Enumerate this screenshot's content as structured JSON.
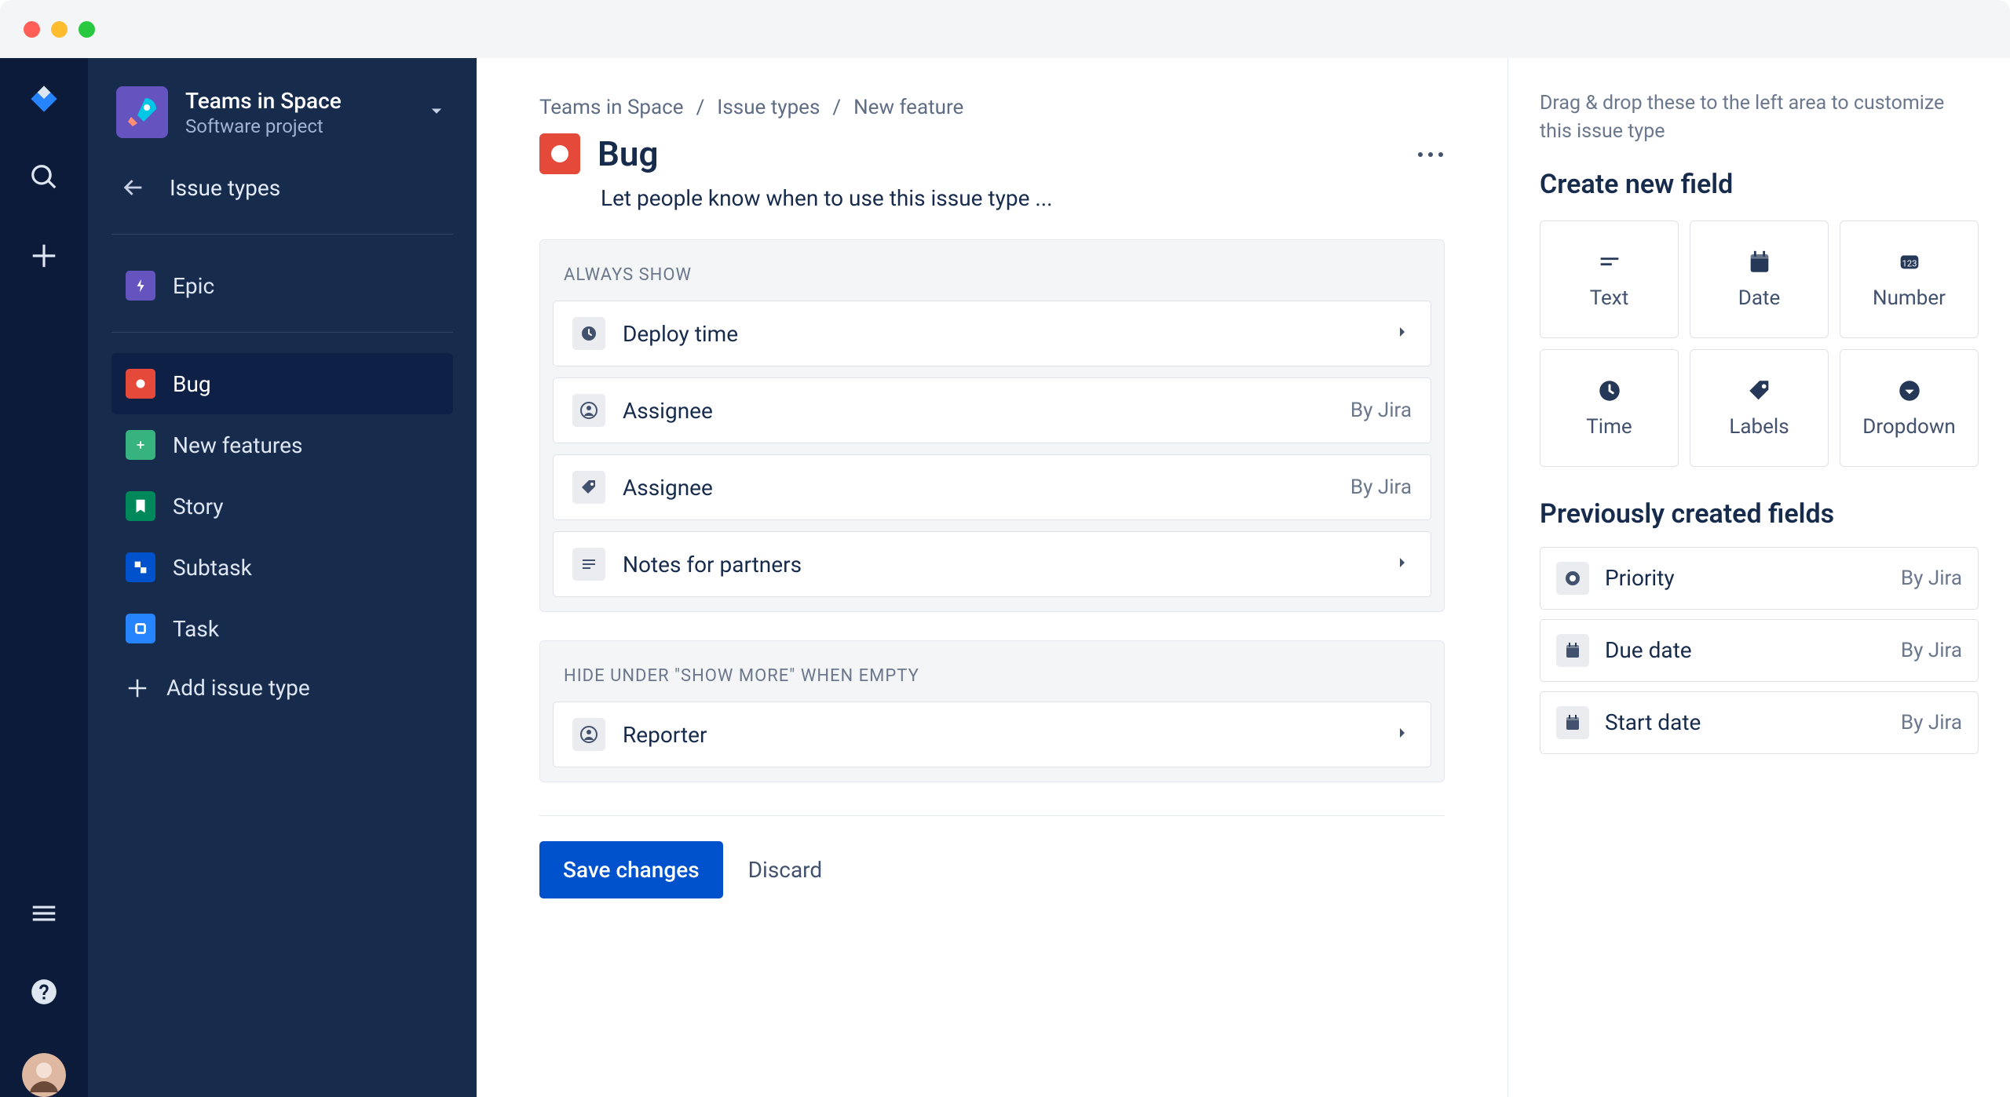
{
  "project": {
    "name": "Teams in Space",
    "subtitle": "Software project"
  },
  "sidebar": {
    "back_label": "Issue types",
    "epic": "Epic",
    "items": [
      "Bug",
      "New features",
      "Story",
      "Subtask",
      "Task"
    ],
    "add_label": "Add issue type"
  },
  "breadcrumbs": [
    "Teams in Space",
    "Issue types",
    "New feature"
  ],
  "page": {
    "title": "Bug",
    "description": "Let people know when to use this issue type ..."
  },
  "groups": {
    "always": {
      "header": "ALWAYS SHOW",
      "fields": [
        {
          "label": "Deploy time",
          "icon": "clock",
          "chevron": true
        },
        {
          "label": "Assignee",
          "icon": "person",
          "by_jira": "By Jira"
        },
        {
          "label": "Assignee",
          "icon": "tag",
          "by_jira": "By Jira"
        },
        {
          "label": "Notes for partners",
          "icon": "text",
          "chevron": true
        }
      ]
    },
    "hide": {
      "header": "HIDE UNDER \"SHOW MORE\" WHEN EMPTY",
      "fields": [
        {
          "label": "Reporter",
          "icon": "person",
          "chevron": true
        }
      ]
    }
  },
  "buttons": {
    "save": "Save changes",
    "discard": "Discard"
  },
  "right": {
    "hint": "Drag & drop these to the left area to customize this issue type",
    "create_heading": "Create new field",
    "tiles": [
      "Text",
      "Date",
      "Number",
      "Time",
      "Labels",
      "Dropdown"
    ],
    "prev_heading": "Previously created fields",
    "prev": [
      {
        "label": "Priority",
        "icon": "radio",
        "by": "By Jira"
      },
      {
        "label": "Due date",
        "icon": "calendar",
        "by": "By Jira"
      },
      {
        "label": "Start date",
        "icon": "calendar",
        "by": "By Jira"
      }
    ]
  }
}
